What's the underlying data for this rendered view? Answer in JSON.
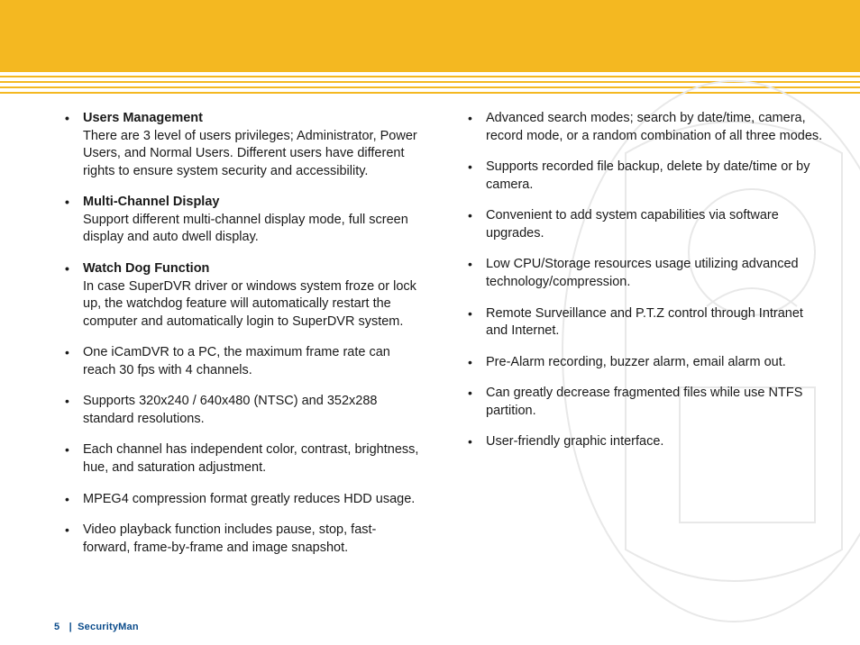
{
  "header": {
    "brand_color": "#f4b821"
  },
  "footer": {
    "page_number": "5",
    "separator": "|",
    "brand": "SecurityMan"
  },
  "left_column": [
    {
      "title": "Users Management",
      "body": "There are 3 level of users privileges; Administrator, Power Users, and Normal Users.  Different users have different rights to ensure system security and accessibility."
    },
    {
      "title": "Multi-Channel Display",
      "body": "Support different multi-channel display mode, full screen display and auto dwell display."
    },
    {
      "title": "Watch Dog Function",
      "body": "In case SuperDVR driver or windows system froze or lock up, the watchdog feature will automatically restart the computer and automatically login to SuperDVR system."
    },
    {
      "title": "",
      "body": "One iCamDVR to a PC, the maximum frame rate can reach 30 fps with 4 channels."
    },
    {
      "title": "",
      "body": "Supports 320x240 / 640x480 (NTSC) and 352x288 standard resolutions."
    },
    {
      "title": "",
      "body": "Each channel has independent color, contrast, brightness, hue, and saturation adjustment."
    },
    {
      "title": "",
      "body": "MPEG4 compression format greatly reduces HDD usage."
    },
    {
      "title": "",
      "body": "Video playback function includes pause, stop, fast-forward, frame-by-frame and image snapshot."
    }
  ],
  "right_column": [
    {
      "title": "",
      "body": "Advanced search modes; search by date/time, camera, record mode, or a random combination of all three modes."
    },
    {
      "title": "",
      "body": "Supports recorded file backup, delete by date/time or by camera."
    },
    {
      "title": "",
      "body": "Convenient to add system capabilities via software upgrades."
    },
    {
      "title": "",
      "body": "Low CPU/Storage resources usage utilizing advanced technology/compression."
    },
    {
      "title": "",
      "body": "Remote Surveillance and P.T.Z control through Intranet and Internet."
    },
    {
      "title": "",
      "body": "Pre-Alarm recording, buzzer alarm, email alarm out."
    },
    {
      "title": "",
      "body": "Can greatly decrease fragmented files while use NTFS partition."
    },
    {
      "title": "",
      "body": "User-friendly graphic interface."
    }
  ]
}
